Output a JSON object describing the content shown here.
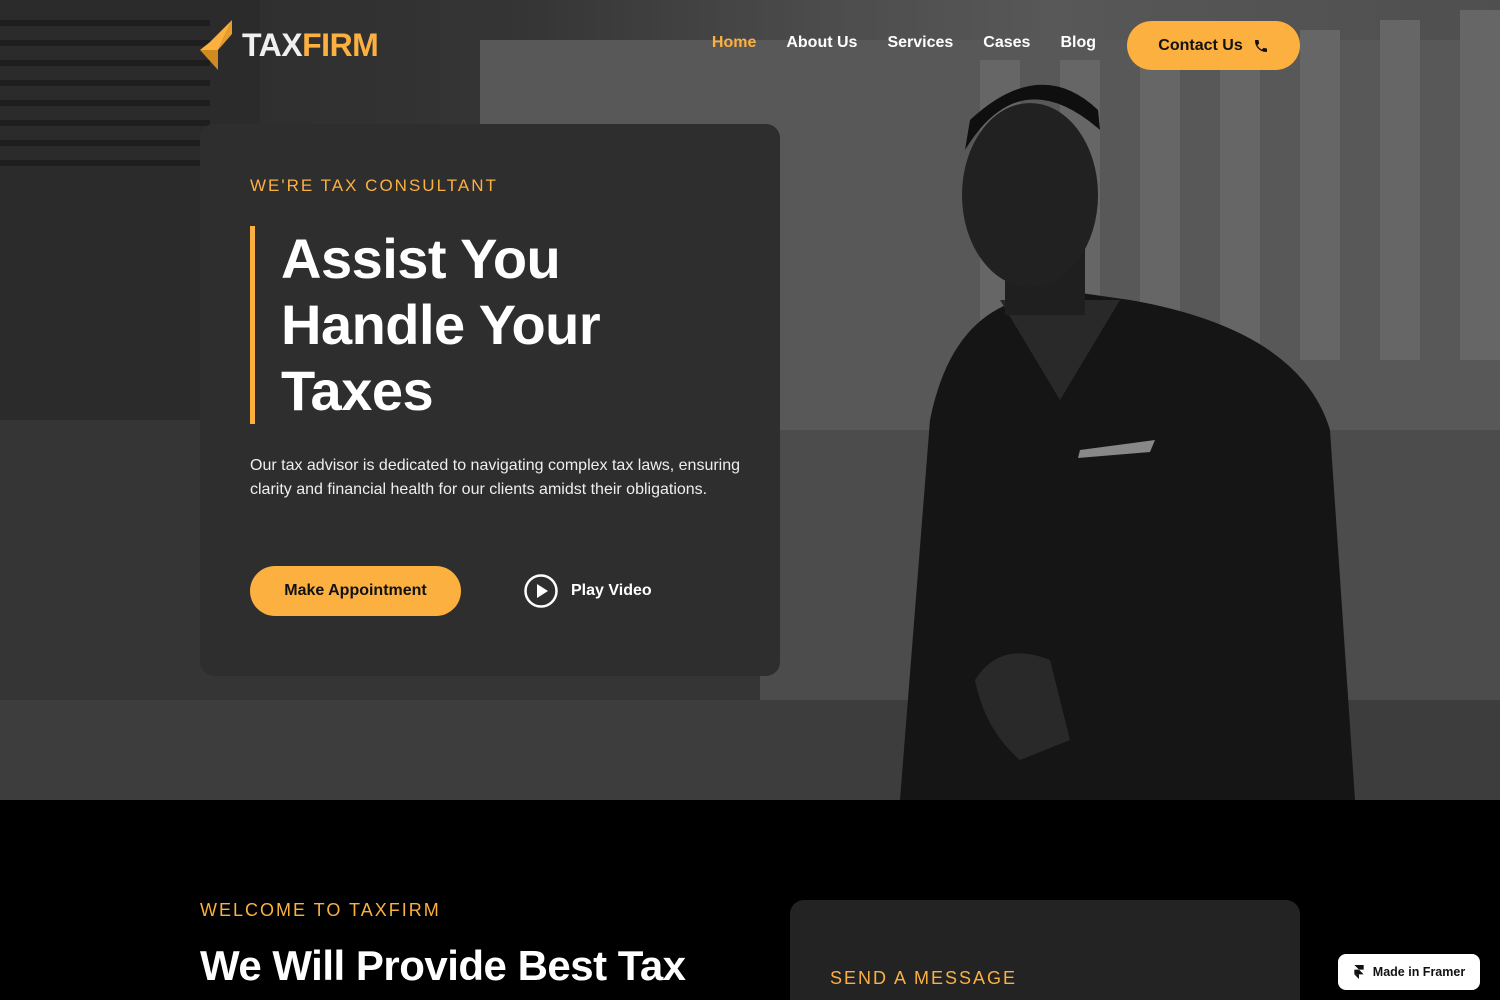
{
  "brand": {
    "name_part1": "TAX",
    "name_part2": "FIRM",
    "accent_color": "#fbb040",
    "logo_icon": "folded-arrow-icon"
  },
  "nav": {
    "items": [
      {
        "label": "Home",
        "active": true
      },
      {
        "label": "About Us",
        "active": false
      },
      {
        "label": "Services",
        "active": false
      },
      {
        "label": "Cases",
        "active": false
      },
      {
        "label": "Blog",
        "active": false
      }
    ],
    "contact_label": "Contact Us",
    "contact_icon": "phone-icon"
  },
  "hero": {
    "eyebrow": "WE'RE TAX CONSULTANT",
    "title": "Assist You Handle Your Taxes",
    "description": "Our tax advisor is dedicated to navigating complex tax laws, ensuring clarity and financial health for our clients amidst their obligations.",
    "primary_button": "Make Appointment",
    "video_button": "Play Video",
    "video_icon": "play-circle-icon"
  },
  "welcome": {
    "eyebrow": "WELCOME TO TAXFIRM",
    "heading": "We Will Provide Best Tax Services For You"
  },
  "message_card": {
    "title": "SEND A MESSAGE"
  },
  "badge": {
    "label": "Made in Framer",
    "icon": "framer-icon"
  }
}
